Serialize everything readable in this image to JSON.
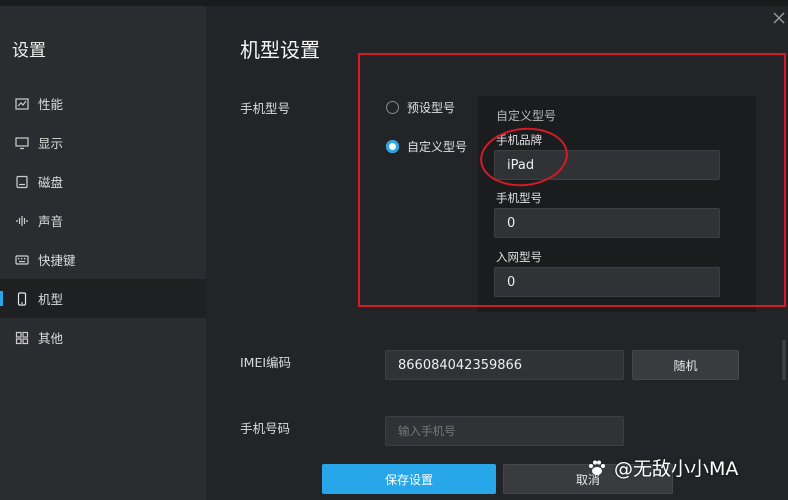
{
  "sidebar": {
    "title": "设置",
    "items": [
      {
        "label": "性能",
        "icon": "chart-icon"
      },
      {
        "label": "显示",
        "icon": "monitor-icon"
      },
      {
        "label": "磁盘",
        "icon": "disk-icon"
      },
      {
        "label": "声音",
        "icon": "sound-wave-icon"
      },
      {
        "label": "快捷键",
        "icon": "keyboard-icon"
      },
      {
        "label": "机型",
        "icon": "phone-icon",
        "active": true
      },
      {
        "label": "其他",
        "icon": "grid-icon"
      }
    ]
  },
  "main": {
    "title": "机型设置",
    "phone_model": {
      "label": "手机型号",
      "options": [
        {
          "label": "预设型号",
          "checked": false
        },
        {
          "label": "自定义型号",
          "checked": true
        }
      ],
      "custom": {
        "title": "自定义型号",
        "brand_label": "手机品牌",
        "brand_value": "iPad",
        "model_label": "手机型号",
        "model_value": "0",
        "network_label": "入网型号",
        "network_value": "0"
      }
    },
    "imei": {
      "label": "IMEI编码",
      "value": "866084042359866",
      "random_button": "随机"
    },
    "phone_number": {
      "label": "手机号码",
      "placeholder": "输入手机号"
    },
    "save_button": "保存设置",
    "cancel_button": "取消"
  },
  "watermark": "@无敌小小MA",
  "colors": {
    "accent": "#27a7ea",
    "annotation": "#d41b26",
    "sidebar_bg": "#2b2c2f",
    "content_bg": "#232427"
  }
}
